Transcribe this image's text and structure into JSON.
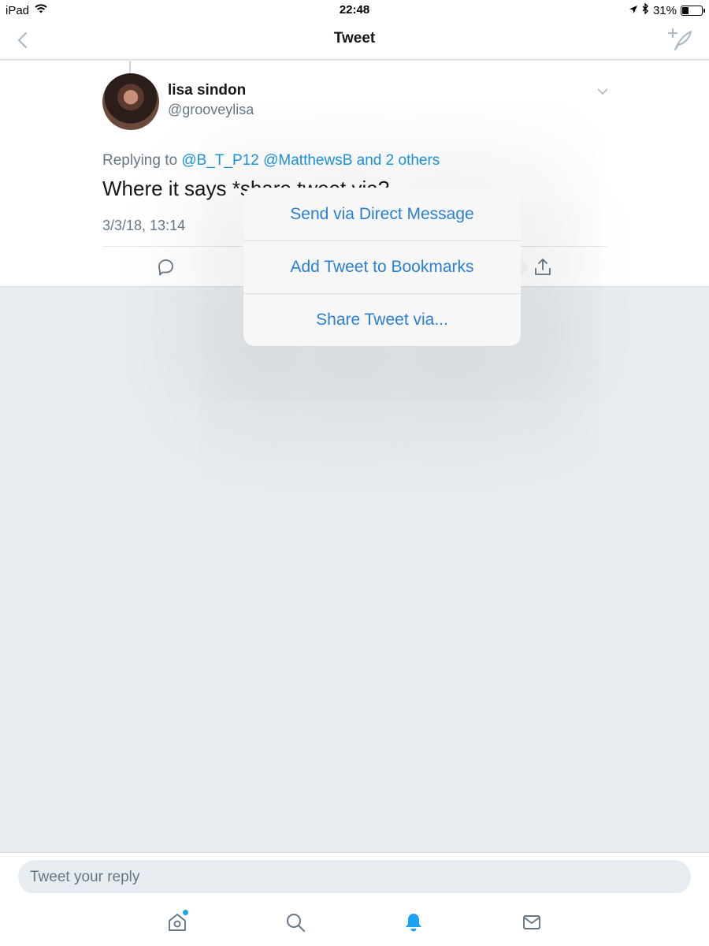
{
  "status_bar": {
    "device": "iPad",
    "time": "22:48",
    "battery_percent": "31%",
    "battery_level": 0.31
  },
  "nav": {
    "title": "Tweet",
    "back_icon": "chevron-left-icon",
    "compose_icon": "compose-tweet-icon"
  },
  "tweet": {
    "user_name": "lisa sindon",
    "user_handle": "@grooveylisa",
    "replying_label": "Replying to",
    "reply_mentions": "@B_T_P12 @MatthewsB and 2 others",
    "text": "Where it says *share tweet via?",
    "timestamp": "3/3/18, 13:14"
  },
  "share_menu": {
    "items": [
      {
        "label": "Send via Direct Message"
      },
      {
        "label": "Add Tweet to Bookmarks"
      },
      {
        "label": "Share Tweet via..."
      }
    ]
  },
  "reply_bar": {
    "placeholder": "Tweet your reply"
  },
  "tab_bar": {
    "tabs": [
      {
        "icon": "home-icon",
        "active": false,
        "has_badge": true
      },
      {
        "icon": "search-icon",
        "active": false
      },
      {
        "icon": "notifications-bell-icon",
        "active": true
      },
      {
        "icon": "messages-mail-icon",
        "active": false
      }
    ]
  },
  "colors": {
    "accent": "#1da1f2",
    "link": "#1b95e0",
    "menu_text": "#2a7fd4",
    "secondary_text": "#657786",
    "background": "#e6ecf0"
  }
}
